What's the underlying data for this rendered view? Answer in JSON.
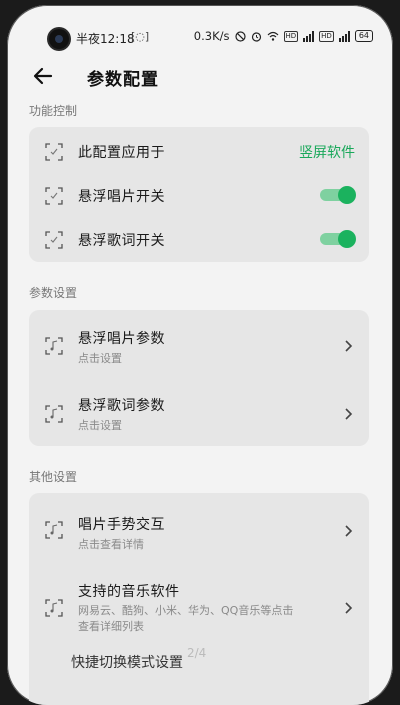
{
  "status": {
    "time": "半夜12:18",
    "screenshot_icon": "[◌]",
    "net_speed": "0.3K/s",
    "hd1": "HD",
    "hd2": "HD",
    "battery": "64"
  },
  "appbar": {
    "title": "参数配置"
  },
  "sections": {
    "function": {
      "header": "功能控制",
      "rows": [
        {
          "label": "此配置应用于",
          "value": "竖屏软件"
        },
        {
          "label": "悬浮唱片开关",
          "toggle": true
        },
        {
          "label": "悬浮歌词开关",
          "toggle": true
        }
      ]
    },
    "params": {
      "header": "参数设置",
      "rows": [
        {
          "label": "悬浮唱片参数",
          "sub": "点击设置"
        },
        {
          "label": "悬浮歌词参数",
          "sub": "点击设置"
        }
      ]
    },
    "other": {
      "header": "其他设置",
      "rows": [
        {
          "label": "唱片手势交互",
          "sub": "点击查看详情"
        },
        {
          "label": "支持的音乐软件",
          "sub1": "网易云、酷狗、小米、华为、QQ音乐等点击",
          "sub2": "查看详细列表"
        }
      ],
      "cut_label": "快捷切换模式设置"
    }
  },
  "pager": "2/4",
  "colors": {
    "accent": "#19a85a",
    "toggle_on": "#1bb25e",
    "card_bg": "#e6e6e6",
    "page_bg": "#f3f3f3"
  }
}
